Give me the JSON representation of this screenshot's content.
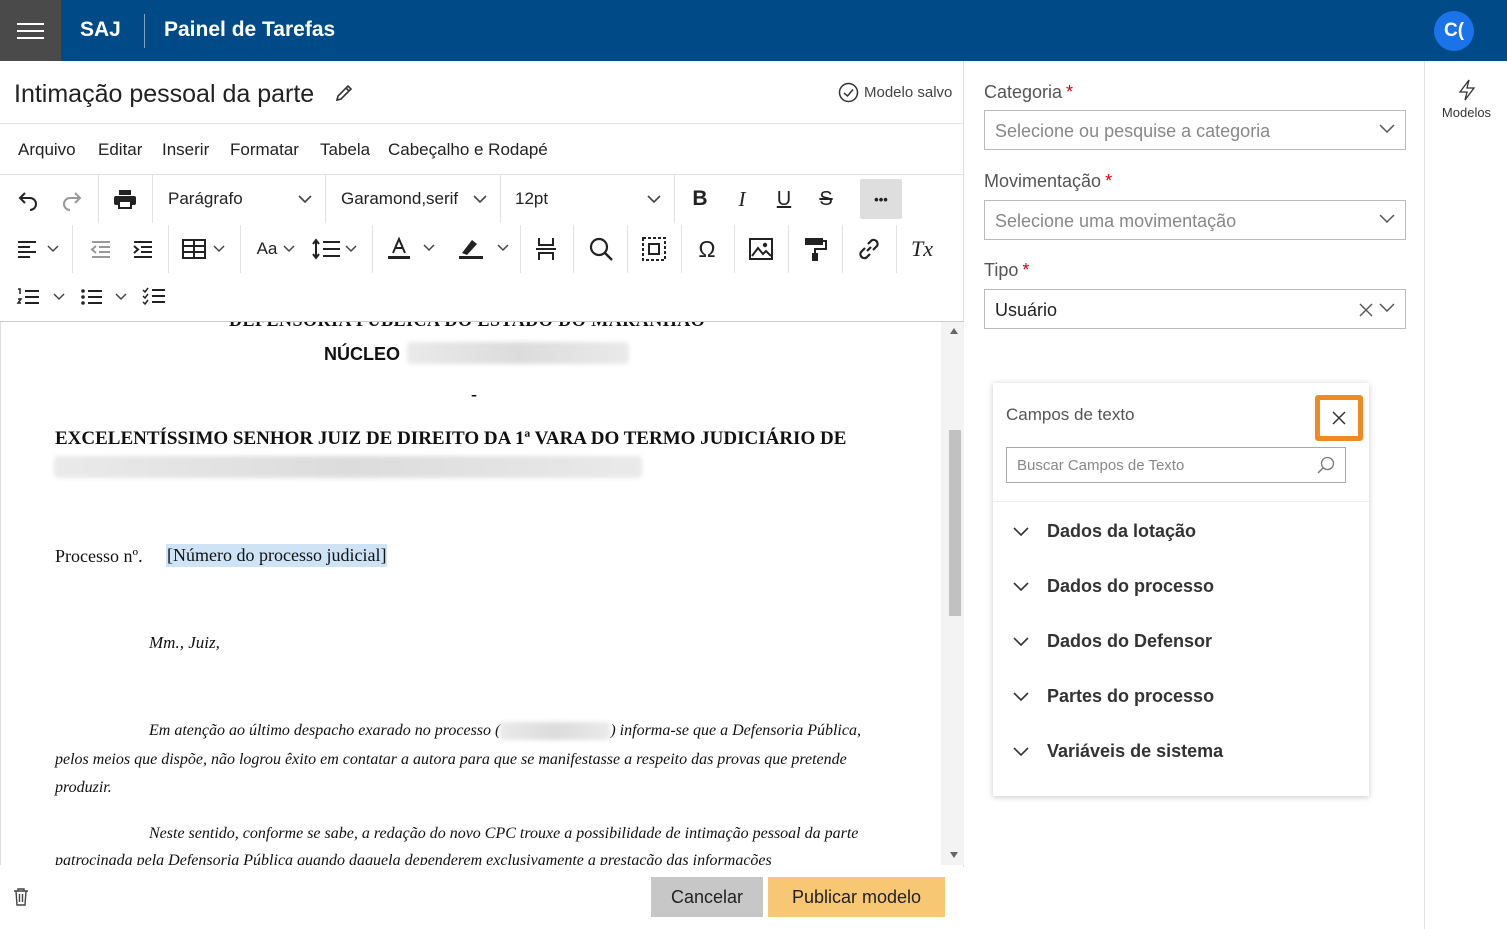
{
  "topbar": {
    "brand": "SAJ",
    "title": "Painel de Tarefas",
    "avatar": "C("
  },
  "editor": {
    "doc_title": "Intimação pessoal da parte",
    "saved_status": "Modelo salvo",
    "menu": [
      "Arquivo",
      "Editar",
      "Inserir",
      "Formatar",
      "Tabela",
      "Cabeçalho e Rodapé"
    ],
    "toolbar": {
      "paragraph": "Parágrafo",
      "font": "Garamond,serif",
      "size": "12pt",
      "case_label": "Aa",
      "bold": "B",
      "italic": "I",
      "underline": "U",
      "strike": "S",
      "more": "•••",
      "omega": "Ω",
      "clear": "Tx"
    }
  },
  "document": {
    "line_header_cut": "DEFENSORIA PÚBLICA DO ESTADO DO MARANHÃO",
    "nucleo": "NÚCLEO",
    "dash": "-",
    "addressee": "EXCELENTÍSSIMO SENHOR JUIZ DE DIREITO DA 1ª VARA DO TERMO JUDICIÁRIO DE",
    "processo_label": "Processo nº.",
    "processo_field": "[Número do processo judicial]",
    "greeting": "Mm., Juiz,",
    "para1_a": "Em atenção ao último despacho exarado no processo (",
    "para1_b": ") informa-se que a Defensoria Pública,",
    "para1_line2": "pelos meios que dispõe, não logrou êxito em contatar a autora para que se manifestasse a respeito das provas que pretende",
    "para1_line3": "produzir.",
    "para2_line1": "Neste sentido, conforme se sabe, a redação do novo CPC trouxe a possibilidade de intimação pessoal da parte",
    "para2_line2": "patrocinada pela Defensoria Pública quando daquela dependerem exclusivamente a prestação das informações"
  },
  "actions": {
    "cancel": "Cancelar",
    "publish": "Publicar modelo"
  },
  "form": {
    "categoria": {
      "label": "Categoria",
      "placeholder": "Selecione ou pesquise a categoria"
    },
    "movimentacao": {
      "label": "Movimentação",
      "placeholder": "Selecione uma movimentação"
    },
    "tipo": {
      "label": "Tipo",
      "value": "Usuário"
    },
    "required_mark": "*"
  },
  "panel": {
    "title": "Campos de texto",
    "search_placeholder": "Buscar Campos de Texto",
    "items": [
      "Dados da lotação",
      "Dados do processo",
      "Dados do Defensor",
      "Partes do processo",
      "Variáveis de sistema"
    ]
  },
  "sidebar": {
    "models_label": "Modelos"
  },
  "colors": {
    "topbar": "#004b87",
    "accent": "#f08a24",
    "publish": "#f7c774",
    "avatar": "#1a73e8"
  }
}
